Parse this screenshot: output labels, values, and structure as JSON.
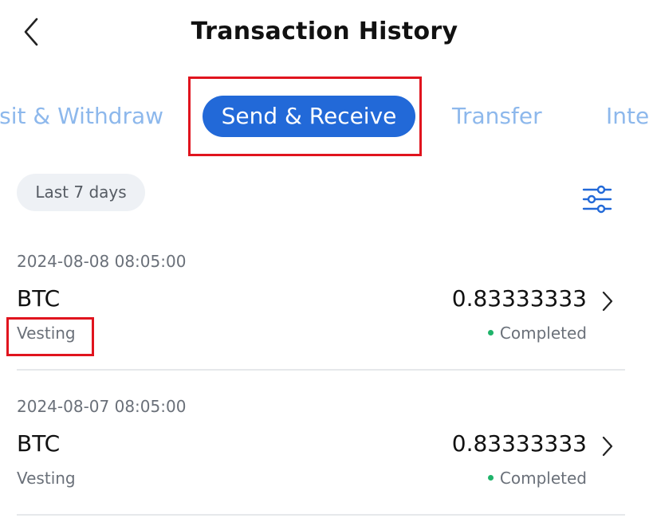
{
  "header": {
    "title": "Transaction History",
    "back_icon": "chevron-left-icon"
  },
  "tabs": [
    {
      "label": "Deposit & Withdraw",
      "visible_text": "osit & Withdraw",
      "active": false
    },
    {
      "label": "Send & Receive",
      "visible_text": "Send & Receive",
      "active": true
    },
    {
      "label": "Transfer",
      "visible_text": "Transfer",
      "active": false
    },
    {
      "label": "Interest",
      "visible_text": "Inte",
      "active": false
    }
  ],
  "filter": {
    "range_label": "Last 7 days",
    "filter_icon": "sliders-icon"
  },
  "transactions": [
    {
      "date": "2024-08-08 08:05:00",
      "asset": "BTC",
      "type": "Vesting",
      "amount": "0.83333333",
      "status": "Completed"
    },
    {
      "date": "2024-08-07 08:05:00",
      "asset": "BTC",
      "type": "Vesting",
      "amount": "0.83333333",
      "status": "Completed"
    }
  ],
  "colors": {
    "accent": "#2269d8",
    "inactive_tab": "#8db8ec",
    "status_completed": "#1fb36a",
    "highlight_box": "#e0141e"
  }
}
